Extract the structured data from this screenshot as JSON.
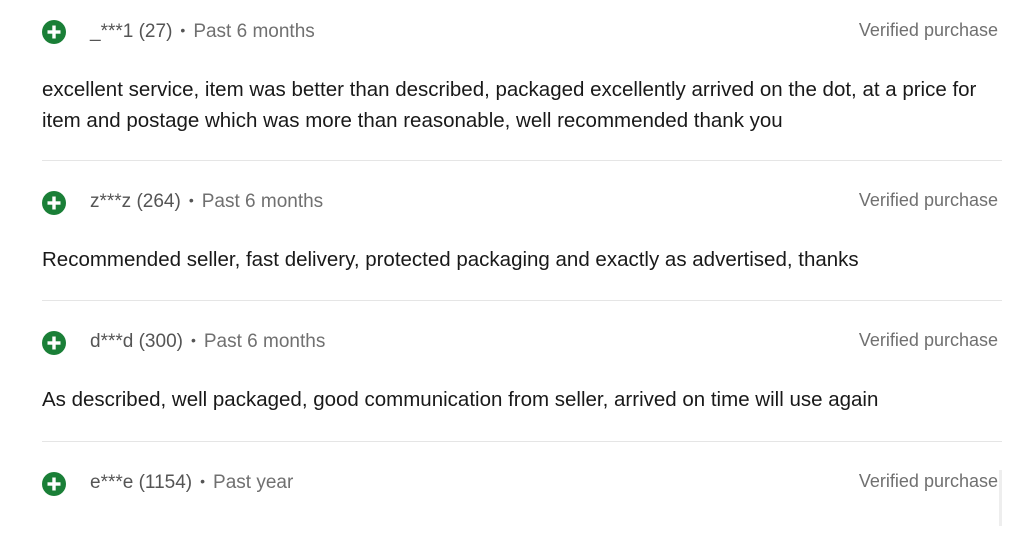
{
  "feedback": [
    {
      "username": "_***1",
      "score": "(27)",
      "separator": "•",
      "time": "Past 6 months",
      "verified": "Verified purchase",
      "comment": "excellent service, item was better than described, packaged excellently arrived on the dot, at a price for item and postage which was more than reasonable, well recommended thank you"
    },
    {
      "username": "z***z",
      "score": "(264)",
      "separator": "•",
      "time": "Past 6 months",
      "verified": "Verified purchase",
      "comment": "Recommended seller, fast delivery, protected packaging and exactly as advertised, thanks"
    },
    {
      "username": "d***d",
      "score": "(300)",
      "separator": "•",
      "time": "Past 6 months",
      "verified": "Verified purchase",
      "comment": "As described, well packaged, good communication from seller, arrived on time will use again"
    },
    {
      "username": "e***e",
      "score": "(1154)",
      "separator": "•",
      "time": "Past year",
      "verified": "Verified purchase",
      "comment": ""
    }
  ],
  "colors": {
    "positive_icon": "#1a7f37",
    "divider": "#e5e5e5",
    "muted_text": "#707070"
  },
  "icons": {
    "rating": "plus-circle-icon"
  }
}
